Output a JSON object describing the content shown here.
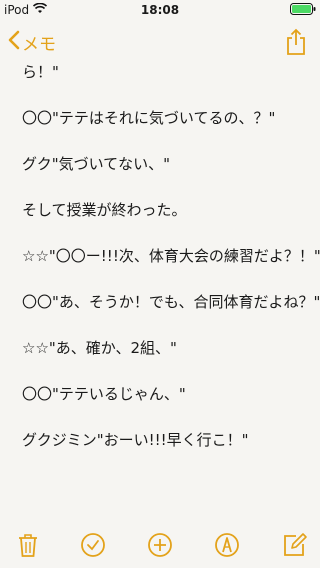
{
  "status": {
    "carrier": "iPod",
    "time": "18:08"
  },
  "nav": {
    "back_label": "メモ"
  },
  "note": {
    "lines": [
      "ら！\"",
      "〇〇\"テテはそれに気づいてるの、？\"",
      "グク\"気づいてない、\"",
      "そして授業が終わった。",
      "☆☆\"〇〇ー!!!次、体育大会の練習だよ？！\"",
      "〇〇\"あ、そうか！でも、合同体育だよね？\"",
      "☆☆\"あ、確か、2組、\"",
      "〇〇\"テテいるじゃん、\"",
      "グクジミン\"おーい!!!早く行こ！\""
    ]
  },
  "colors": {
    "accent": "#e3a21a",
    "background": "#f6f5f2",
    "text": "#1a1a1a"
  },
  "icons": [
    "wifi-icon",
    "battery-icon",
    "chevron-left-icon",
    "share-icon",
    "trash-icon",
    "checklist-icon",
    "add-icon",
    "sketch-icon",
    "compose-icon"
  ]
}
